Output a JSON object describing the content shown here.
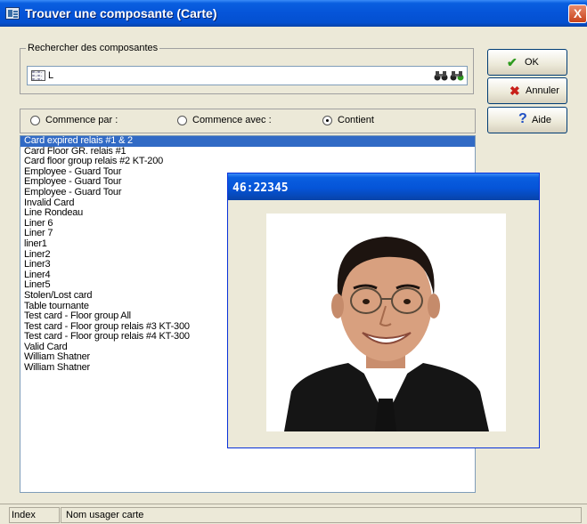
{
  "window": {
    "title": "Trouver une composante (Carte)",
    "close_glyph": "X"
  },
  "search": {
    "group_label": "Rechercher des composantes",
    "value": "L"
  },
  "options": [
    {
      "label": "Commence par :",
      "selected": false
    },
    {
      "label": "Commence avec :",
      "selected": false
    },
    {
      "label": "Contient",
      "selected": true
    }
  ],
  "buttons": {
    "ok": {
      "label": "OK",
      "icon": "check-icon"
    },
    "cancel": {
      "label": "Annuler",
      "icon": "x-icon"
    },
    "help": {
      "label": "Aide",
      "icon": "question-icon"
    }
  },
  "results": [
    "Card expired relais #1 & 2",
    "Card Floor GR. relais #1",
    "Card floor group relais #2  KT-200",
    "Employee - Guard Tour",
    "Employee - Guard Tour",
    "Employee - Guard Tour",
    "Invalid Card",
    "Line Rondeau",
    "Liner 6",
    "Liner 7",
    "liner1",
    "Liner2",
    "Liner3",
    "Liner4",
    "Liner5",
    "Stolen/Lost card",
    "Table tournante",
    "Test card - Floor group All",
    "Test card - Floor group relais #3 KT-300",
    "Test card - Floor group relais #4 KT-300",
    "Valid Card",
    "William Shatner",
    "William Shatner"
  ],
  "selected_index": 0,
  "popup": {
    "title": "46:22345"
  },
  "status": {
    "index_label": "Index",
    "field_label": "Nom usager carte"
  },
  "colors": {
    "titlebar": "#0554d8",
    "selection": "#316ac5",
    "ok_icon": "#2e9b1f",
    "cancel_icon": "#c8201a",
    "help_icon": "#1f4fc4"
  }
}
